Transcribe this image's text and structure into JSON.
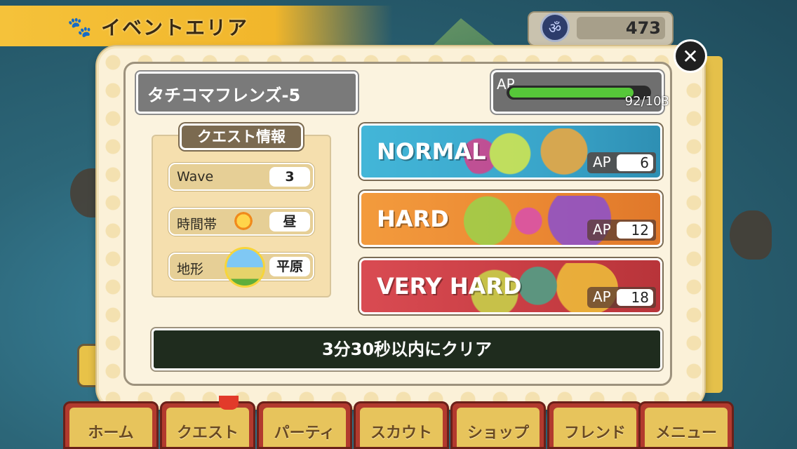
{
  "header": {
    "title": "イベントエリア",
    "paw_icon": "paw-icon",
    "currency": {
      "icon": "emblem-icon",
      "value": "473"
    }
  },
  "quest": {
    "name": "タチコマフレンズ-5",
    "ap": {
      "label": "AP",
      "current": 92,
      "max": 103,
      "display": "92/103",
      "fill_fraction": 0.893
    }
  },
  "quest_info": {
    "title": "クエスト情報",
    "rows": [
      {
        "label": "Wave",
        "value": "3"
      },
      {
        "label": "時間帯",
        "value": "昼",
        "icon": "sun-icon"
      },
      {
        "label": "地形",
        "value": "平原",
        "icon": "plains-icon"
      }
    ]
  },
  "difficulties": [
    {
      "label": "NORMAL",
      "ap_label": "AP",
      "ap": "6",
      "color": "#43b6d8"
    },
    {
      "label": "HARD",
      "ap_label": "AP",
      "ap": "12",
      "color": "#f39b3d"
    },
    {
      "label": "VERY HARD",
      "ap_label": "AP",
      "ap": "18",
      "color": "#d94b52"
    }
  ],
  "clear_condition": "3分30秒以内にクリア",
  "tabs": [
    "ホーム",
    "クエスト",
    "パーティ",
    "スカウト",
    "ショップ",
    "フレンド",
    "メニュー"
  ]
}
